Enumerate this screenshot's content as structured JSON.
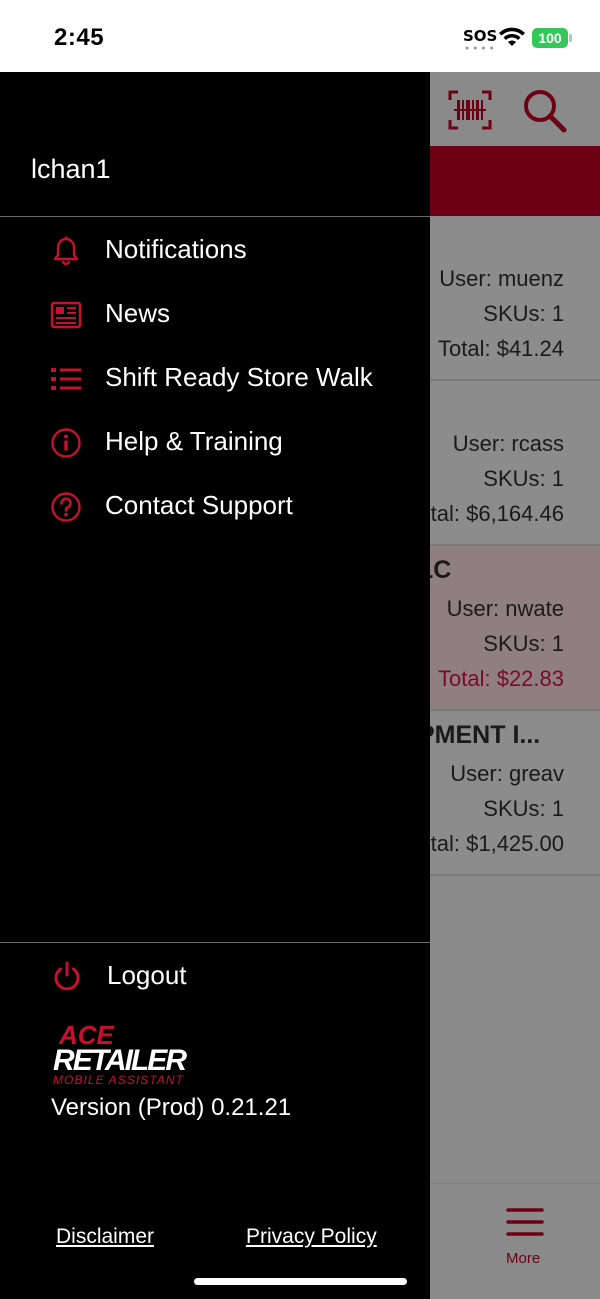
{
  "status_bar": {
    "time": "2:45",
    "sos": "SOS",
    "battery": "100",
    "battery_color": "#34c759"
  },
  "drawer": {
    "username": "lchan1",
    "menu": [
      {
        "label": "Notifications",
        "icon": "bell-icon"
      },
      {
        "label": "News",
        "icon": "newspaper-icon"
      },
      {
        "label": "Shift Ready Store Walk",
        "icon": "list-icon"
      },
      {
        "label": "Help & Training",
        "icon": "info-icon"
      },
      {
        "label": "Contact Support",
        "icon": "question-icon"
      }
    ],
    "logout_label": "Logout",
    "logo": {
      "line1": "ACE",
      "line2": "RETAILER",
      "line3": "MOBILE ASSISTANT"
    },
    "version": "Version (Prod) 0.21.21",
    "disclaimer": "Disclaimer",
    "privacy": "Privacy Policy"
  },
  "background": {
    "cards": [
      {
        "title": "",
        "user": "User: muenz",
        "skus": "SKUs: 1",
        "total": "Total: $41.24"
      },
      {
        "title": "",
        "user": "User: rcass",
        "skus": "SKUs: 1",
        "total": "tal: $6,164.46"
      },
      {
        "title": "LC",
        "user": "User: nwate",
        "skus": "SKUs: 1",
        "total": "Total: $22.83"
      },
      {
        "title": "PMENT I...",
        "user": "User: greav",
        "skus": "SKUs: 1",
        "total": "tal: $1,425.00"
      }
    ],
    "more_label": "More"
  },
  "colors": {
    "accent": "#c8102e",
    "dark_accent": "#6e0016"
  }
}
